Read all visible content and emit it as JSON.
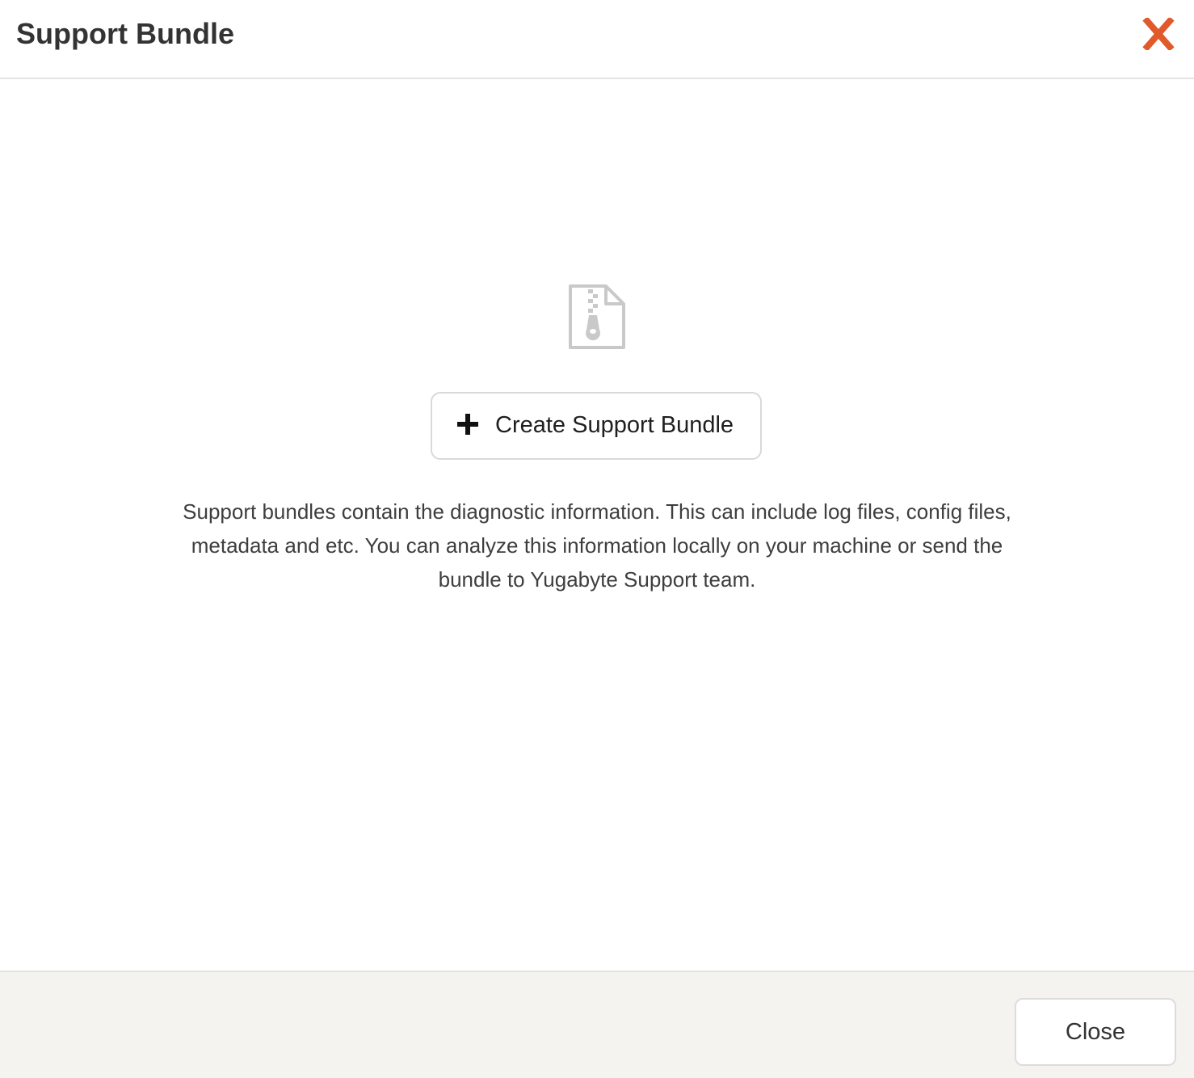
{
  "dialog": {
    "title": "Support Bundle"
  },
  "colors": {
    "close_icon": "#e05a2b",
    "icon_gray": "#c9c9c9",
    "footer_bg": "#f4f3f0",
    "border": "#d9d9d9"
  },
  "icons": {
    "close": "close-x-icon",
    "empty_state": "zip-file-icon",
    "add": "plus-icon"
  },
  "body": {
    "create_button_label": "Create Support Bundle",
    "description": "Support bundles contain the diagnostic information. This can include log files, config files, metadata and etc. You can analyze this information locally on your machine or send the bundle to Yugabyte Support team."
  },
  "footer": {
    "close_label": "Close"
  }
}
